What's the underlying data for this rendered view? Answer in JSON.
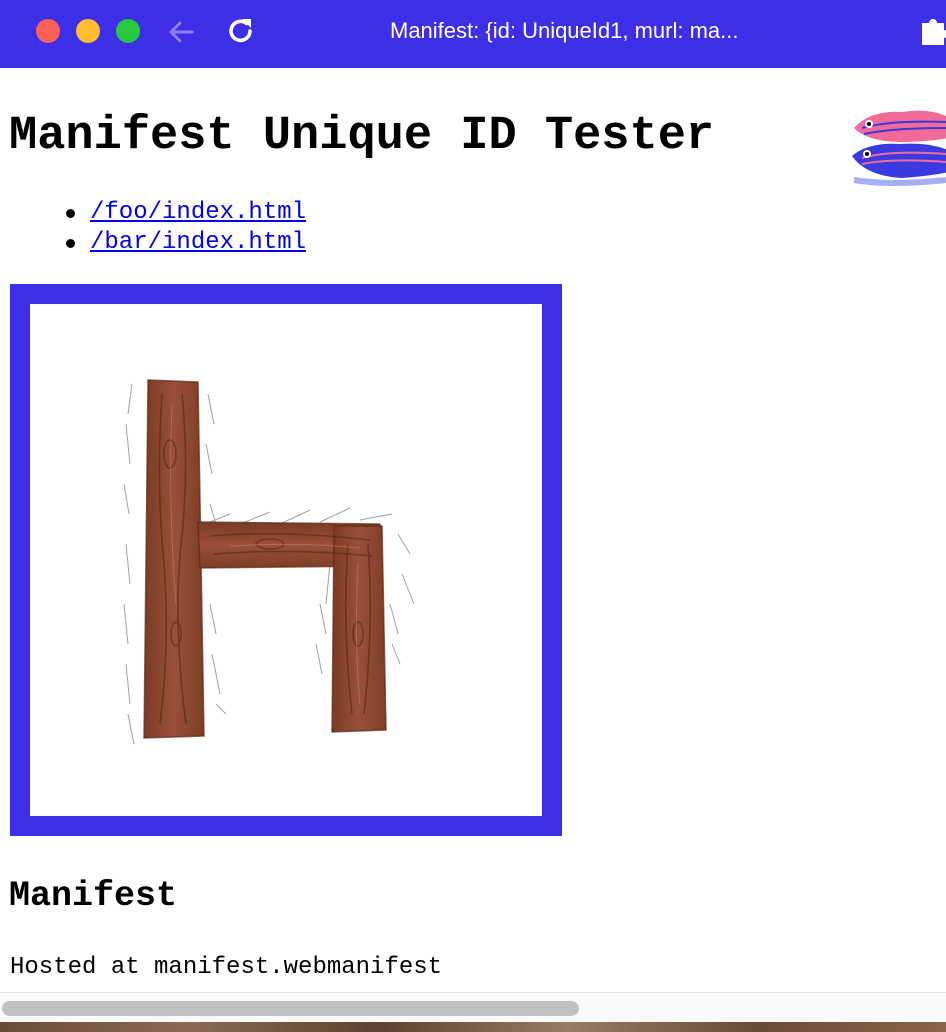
{
  "window": {
    "title": "Manifest: {id: UniqueId1, murl: ma..."
  },
  "toolbar": {
    "icons": [
      "close-button",
      "minimize-button",
      "maximize-button",
      "back-arrow-icon",
      "reload-icon",
      "puzzle-extension-icon"
    ]
  },
  "page": {
    "title": "Manifest Unique ID Tester",
    "logo": "fish-logo",
    "links": [
      {
        "label": "/foo/index.html"
      },
      {
        "label": "/bar/index.html"
      }
    ],
    "app_icon": "wooden-h-letter-icon",
    "manifest_heading": "Manifest",
    "hosted_text": "Hosted at manifest.webmanifest"
  },
  "colors": {
    "titlebar": "#3d2ee8",
    "frame_border": "#3d2ee8",
    "link": "#0000ee",
    "wood": "#8a4630"
  }
}
